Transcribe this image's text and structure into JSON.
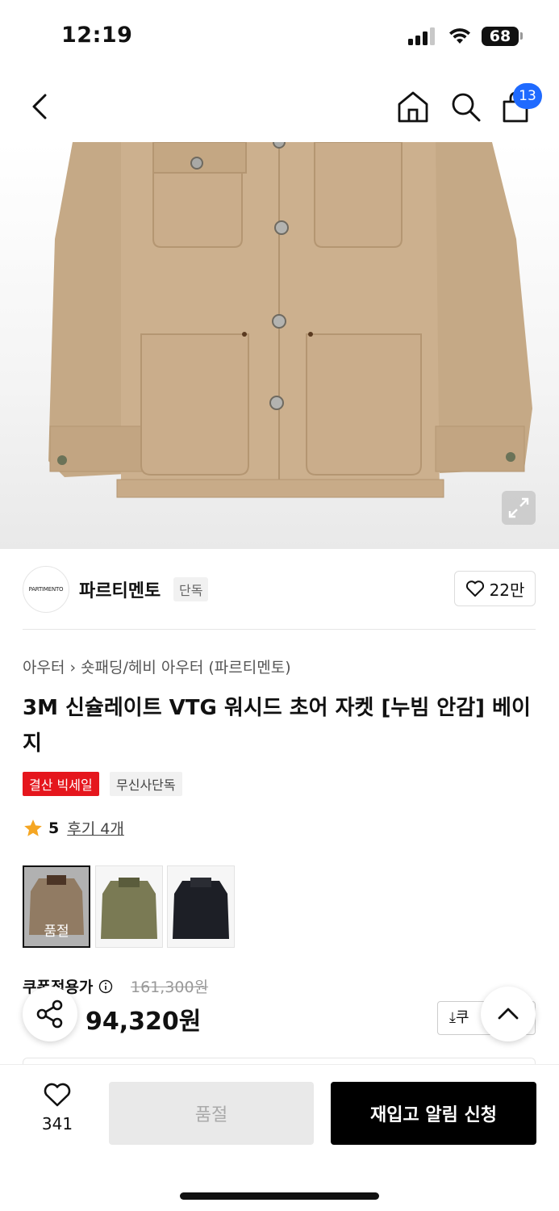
{
  "status_bar": {
    "time": "12:19",
    "battery": "68"
  },
  "header": {
    "cart_count": "13"
  },
  "brand": {
    "logo_text": "PARTIMENTO",
    "name": "파르티멘토",
    "tag": "단독",
    "likes": "22만"
  },
  "breadcrumb": {
    "category": "아우터",
    "subcategory": "숏패딩/헤비 아우터 (파르티멘토)"
  },
  "product": {
    "title": "3M 신슐레이트 VTG 워시드 초어 자켓 [누빔 안감] 베이지",
    "badges": {
      "sale": "결산 빅세일",
      "exclusive": "무신사단독"
    },
    "rating": "5",
    "reviews": "후기 4개"
  },
  "colors": [
    {
      "name": "beige",
      "soldout_label": "품절",
      "color": "#c9ab8a"
    },
    {
      "name": "khaki",
      "color": "#7a7a54"
    },
    {
      "name": "black",
      "color": "#1d1f26"
    }
  ],
  "price": {
    "coupon_label": "쿠폰적용가",
    "original": "161,300원",
    "final": "94,320원",
    "coupon_button": "쿠"
  },
  "bottom": {
    "wish_count": "341",
    "soldout_label": "품절",
    "restock_label": "재입고 알림 신청"
  },
  "theme": {
    "accent": "#1f6aff",
    "sale_red": "#e5161d",
    "jacket": "#c9ab8a"
  }
}
